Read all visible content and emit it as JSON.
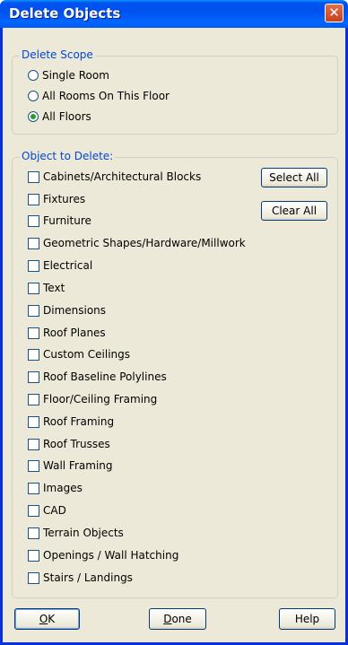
{
  "window": {
    "title": "Delete Objects",
    "close_symbol": "✕"
  },
  "scope": {
    "legend": "Delete Scope",
    "options": [
      {
        "label": "Single Room",
        "selected": false
      },
      {
        "label": "All Rooms On This Floor",
        "selected": false
      },
      {
        "label": "All Floors",
        "selected": true
      }
    ]
  },
  "objects": {
    "legend": "Object to Delete:",
    "items": [
      {
        "label": "Cabinets/Architectural Blocks",
        "checked": false
      },
      {
        "label": "Fixtures",
        "checked": false
      },
      {
        "label": "Furniture",
        "checked": false
      },
      {
        "label": "Geometric Shapes/Hardware/Millwork",
        "checked": false
      },
      {
        "label": "Electrical",
        "checked": false
      },
      {
        "label": "Text",
        "checked": false
      },
      {
        "label": "Dimensions",
        "checked": false
      },
      {
        "label": "Roof Planes",
        "checked": false
      },
      {
        "label": "Custom Ceilings",
        "checked": false
      },
      {
        "label": "Roof Baseline Polylines",
        "checked": false
      },
      {
        "label": "Floor/Ceiling Framing",
        "checked": false
      },
      {
        "label": "Roof Framing",
        "checked": false
      },
      {
        "label": "Roof Trusses",
        "checked": false
      },
      {
        "label": "Wall Framing",
        "checked": false
      },
      {
        "label": "Images",
        "checked": false
      },
      {
        "label": "CAD",
        "checked": false
      },
      {
        "label": "Terrain Objects",
        "checked": false
      },
      {
        "label": "Openings / Wall Hatching",
        "checked": false
      },
      {
        "label": "Stairs / Landings",
        "checked": false
      }
    ],
    "select_all_label": "Select All",
    "clear_all_label": "Clear All"
  },
  "footer": {
    "ok_first": "O",
    "ok_rest": "K",
    "done_first": "D",
    "done_rest": "one",
    "help_label": "Help"
  }
}
